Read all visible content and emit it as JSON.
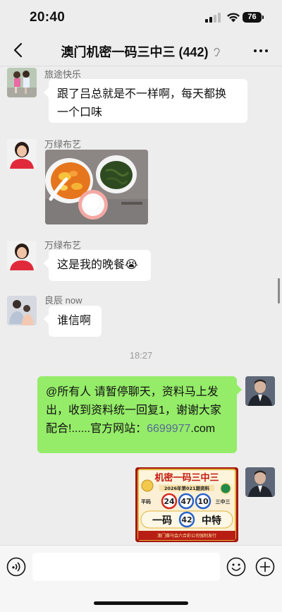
{
  "status_bar": {
    "time": "20:40",
    "battery": "76"
  },
  "header": {
    "title": "澳门机密一码三中三 (442)",
    "back_icon": "chevron-left-icon",
    "more_icon": "more-dots-icon",
    "mute_icon": "ear-icon"
  },
  "messages": [
    {
      "sender": "旅途快乐",
      "text_line1": "跟了吕总就是不一样啊，每天都换",
      "text_line2": "一个口味"
    },
    {
      "sender": "万绿布艺",
      "image": "food-photo"
    },
    {
      "sender": "万绿布艺",
      "text": "这是我的晚餐",
      "emoji": "😭"
    },
    {
      "sender": "良辰 now",
      "text": "谁信啊"
    }
  ],
  "timestamp": "18:27",
  "outgoing": [
    {
      "text_line1": "@所有人 请暂停聊天，资料马上发",
      "text_line2": "出，收到资料统一回复1，谢谢大家",
      "text_line3_prefix": "配合!......官方网站：",
      "link": "6699977",
      "text_line3_suffix": ".com"
    }
  ],
  "poster": {
    "title": "机密一码三中三",
    "issue": "2026年第021期资料",
    "label_left": "平码",
    "numbers": [
      "24",
      "47",
      "10"
    ],
    "label_right": "三中三",
    "yima": "一码",
    "special": "42",
    "zhongte": "中特",
    "footer": "澳门赛马会六合彩公司强制发行"
  },
  "colors": {
    "chat_bg": "#ededed",
    "outgoing_bubble": "#95ec69",
    "link": "#576b95"
  }
}
